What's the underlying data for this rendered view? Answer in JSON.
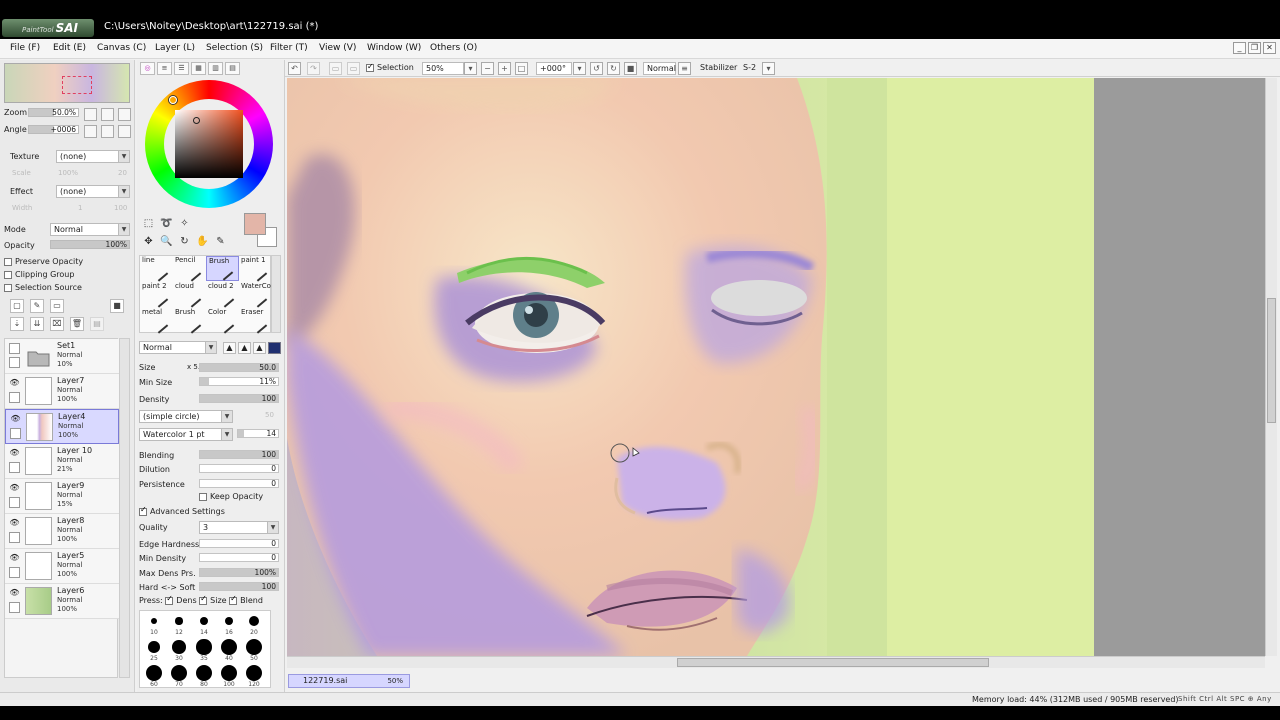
{
  "app": {
    "logo_small": "PaintTool",
    "logo": "SAI",
    "title": "C:\\Users\\Noitey\\Desktop\\art\\122719.sai (*)"
  },
  "menu": [
    {
      "label": "File (F)"
    },
    {
      "label": "Edit (E)"
    },
    {
      "label": "Canvas (C)"
    },
    {
      "label": "Layer (L)"
    },
    {
      "label": "Selection (S)"
    },
    {
      "label": "Filter (T)"
    },
    {
      "label": "View (V)"
    },
    {
      "label": "Window (W)"
    },
    {
      "label": "Others (O)"
    }
  ],
  "nav": {
    "zoom_label": "Zoom",
    "zoom_value": "50.0%",
    "angle_label": "Angle",
    "angle_value": "+0006"
  },
  "texture": {
    "label": "Texture",
    "value": "(none)",
    "scale_label": "Scale",
    "scale_value": "100%",
    "scale_num": "20"
  },
  "effect": {
    "label": "Effect",
    "value": "(none)",
    "width_label": "Width",
    "width_value": "1",
    "width_num": "100"
  },
  "mode": {
    "label": "Mode",
    "value": "Normal"
  },
  "opacity": {
    "label": "Opacity",
    "value": "100%",
    "fill": 1.0
  },
  "checks": {
    "preserve": "Preserve Opacity",
    "clipping": "Clipping Group",
    "selsrc": "Selection Source"
  },
  "layers": [
    {
      "name": "Set1",
      "mode": "Normal",
      "opacity": "10%",
      "folder": true,
      "selected": false,
      "visible": false
    },
    {
      "name": "Layer7",
      "mode": "Normal",
      "opacity": "100%",
      "folder": false,
      "selected": false,
      "visible": true
    },
    {
      "name": "Layer4",
      "mode": "Normal",
      "opacity": "100%",
      "folder": false,
      "selected": true,
      "visible": true
    },
    {
      "name": "Layer 10",
      "mode": "Normal",
      "opacity": "21%",
      "folder": false,
      "selected": false,
      "visible": true
    },
    {
      "name": "Layer9",
      "mode": "Normal",
      "opacity": "15%",
      "folder": false,
      "selected": false,
      "visible": true
    },
    {
      "name": "Layer8",
      "mode": "Normal",
      "opacity": "100%",
      "folder": false,
      "selected": false,
      "visible": true
    },
    {
      "name": "Layer5",
      "mode": "Normal",
      "opacity": "100%",
      "folder": false,
      "selected": false,
      "visible": true
    },
    {
      "name": "Layer6",
      "mode": "Normal",
      "opacity": "100%",
      "folder": false,
      "selected": false,
      "visible": true
    }
  ],
  "colors": {
    "primary": "#e3b5a8",
    "secondary": "#ffffff",
    "selection_accent": "#d6d6ff"
  },
  "brushes": [
    {
      "label": "line"
    },
    {
      "label": "Pencil"
    },
    {
      "label": "Brush",
      "selected": true
    },
    {
      "label": "paint 1"
    },
    {
      "label": "paint 2"
    },
    {
      "label": "cloud"
    },
    {
      "label": "cloud 2"
    },
    {
      "label": "WaterCo"
    },
    {
      "label": "metal"
    },
    {
      "label": "Brush"
    },
    {
      "label": "Color"
    },
    {
      "label": "Eraser"
    }
  ],
  "brush_settings": {
    "blend_mode": "Normal",
    "size_label": "Size",
    "size_mult": "x 5.0",
    "size_value": "50.0",
    "minsize_label": "Min Size",
    "minsize_value": "11%",
    "density_label": "Density",
    "density_value": "100",
    "shape": "(simple circle)",
    "shape_num": "50",
    "texture": "Watercolor 1 pt",
    "texture_num": "14",
    "blending_label": "Blending",
    "blending_value": "100",
    "dilution_label": "Dilution",
    "dilution_value": "0",
    "persistence_label": "Persistence",
    "persistence_value": "0",
    "keep_opacity": "Keep Opacity",
    "advanced": "Advanced Settings",
    "quality_label": "Quality",
    "quality_value": "3",
    "edge_label": "Edge Hardness",
    "edge_value": "0",
    "mindens_label": "Min Density",
    "mindens_value": "0",
    "maxdens_label": "Max Dens Prs.",
    "maxdens_value": "100%",
    "hardsoft_label": "Hard <-> Soft",
    "hardsoft_value": "100",
    "press_label": "Press:",
    "press_dens": "Dens",
    "press_size": "Size",
    "press_blend": "Blend"
  },
  "dot_sizes": [
    "10",
    "12",
    "14",
    "16",
    "20",
    "25",
    "30",
    "35",
    "40",
    "50",
    "60",
    "70",
    "80",
    "100",
    "120"
  ],
  "toolbar": {
    "selection_label": "Selection",
    "zoom_value": "50%",
    "angle_value": "+000°",
    "mode_value": "Normal",
    "stabilizer_label": "Stabilizer",
    "stabilizer_value": "S-2"
  },
  "document": {
    "tab_name": "122719.sai",
    "tab_zoom": "50%"
  },
  "status": {
    "memory": "Memory load: 44% (312MB used / 905MB reserved)",
    "keys": "Shift Ctrl Alt SPC ⊕ Any"
  }
}
